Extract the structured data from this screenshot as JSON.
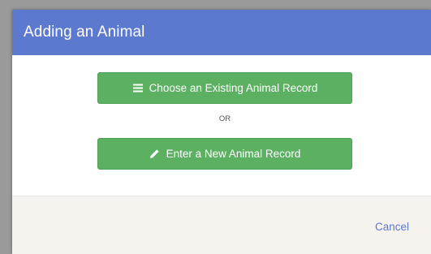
{
  "dialog": {
    "title": "Adding an Animal",
    "choose_existing_label": "Choose an Existing Animal Record",
    "choose_existing_icon": "list-icon",
    "or_label": "OR",
    "new_record_label": "Enter a New Animal Record",
    "new_record_icon": "pencil-icon",
    "cancel_label": "Cancel"
  },
  "colors": {
    "header": "#5b79cf",
    "button": "#5cb062",
    "footer": "#f6f3ef",
    "link": "#5b79cf"
  }
}
